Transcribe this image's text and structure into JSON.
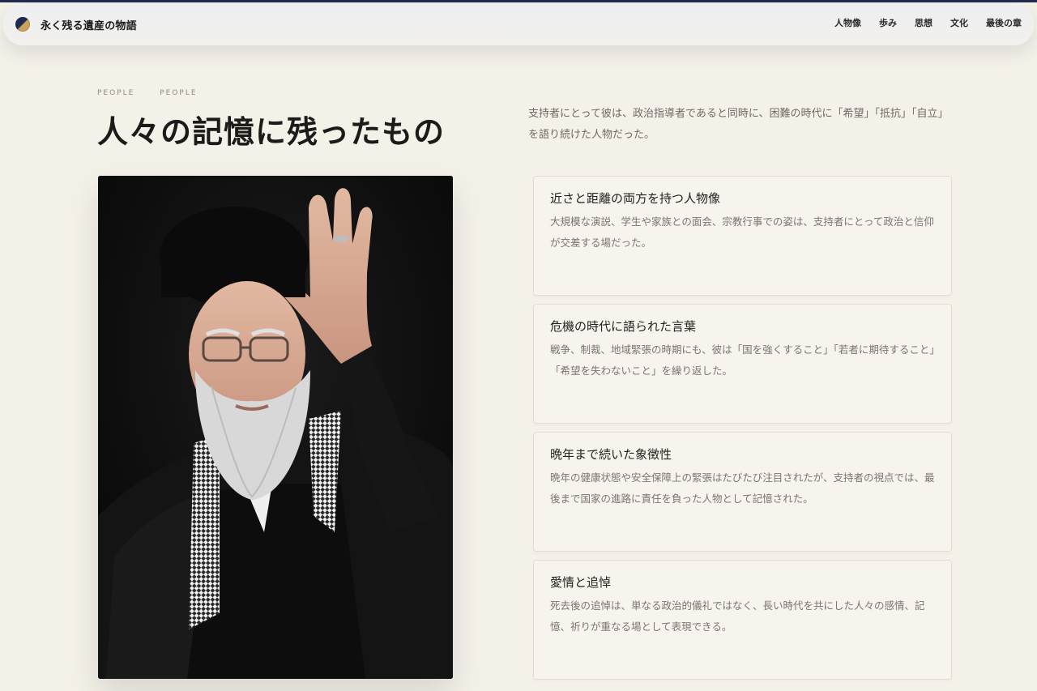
{
  "header": {
    "brand_title": "永く残る遺産の物語",
    "nav": [
      {
        "label": "人物像"
      },
      {
        "label": "歩み"
      },
      {
        "label": "思想"
      },
      {
        "label": "文化"
      },
      {
        "label": "最後の章"
      }
    ]
  },
  "section": {
    "eyebrow": [
      "PEOPLE",
      "PEOPLE"
    ],
    "title": "人々の記憶に残ったもの",
    "lead": "支持者にとって彼は、政治指導者であると同時に、困難の時代に「希望」「抵抗」「自立」を語り続けた人物だった。"
  },
  "cards": [
    {
      "title": "近さと距離の両方を持つ人物像",
      "body": "大規模な演説、学生や家族との面会、宗教行事での姿は、支持者にとって政治と信仰が交差する場だった。"
    },
    {
      "title": "危機の時代に語られた言葉",
      "body": "戦争、制裁、地域緊張の時期にも、彼は「国を強くすること」「若者に期待すること」「希望を失わないこと」を繰り返した。"
    },
    {
      "title": "晩年まで続いた象徴性",
      "body": "晩年の健康状態や安全保障上の緊張はたびたび注目されたが、支持者の視点では、最後まで国家の進路に責任を負った人物として記憶された。"
    },
    {
      "title": "愛情と追悼",
      "body": "死去後の追悼は、単なる政治的儀礼ではなく、長い時代を共にした人々の感情、記憶、祈りが重なる場として表現できる。"
    }
  ],
  "colors": {
    "background": "#f4f1e9",
    "accent_navy": "#1f2a4d",
    "accent_gold": "#c9a25b"
  },
  "icons": {
    "logo": "half-moon-logo-icon"
  }
}
